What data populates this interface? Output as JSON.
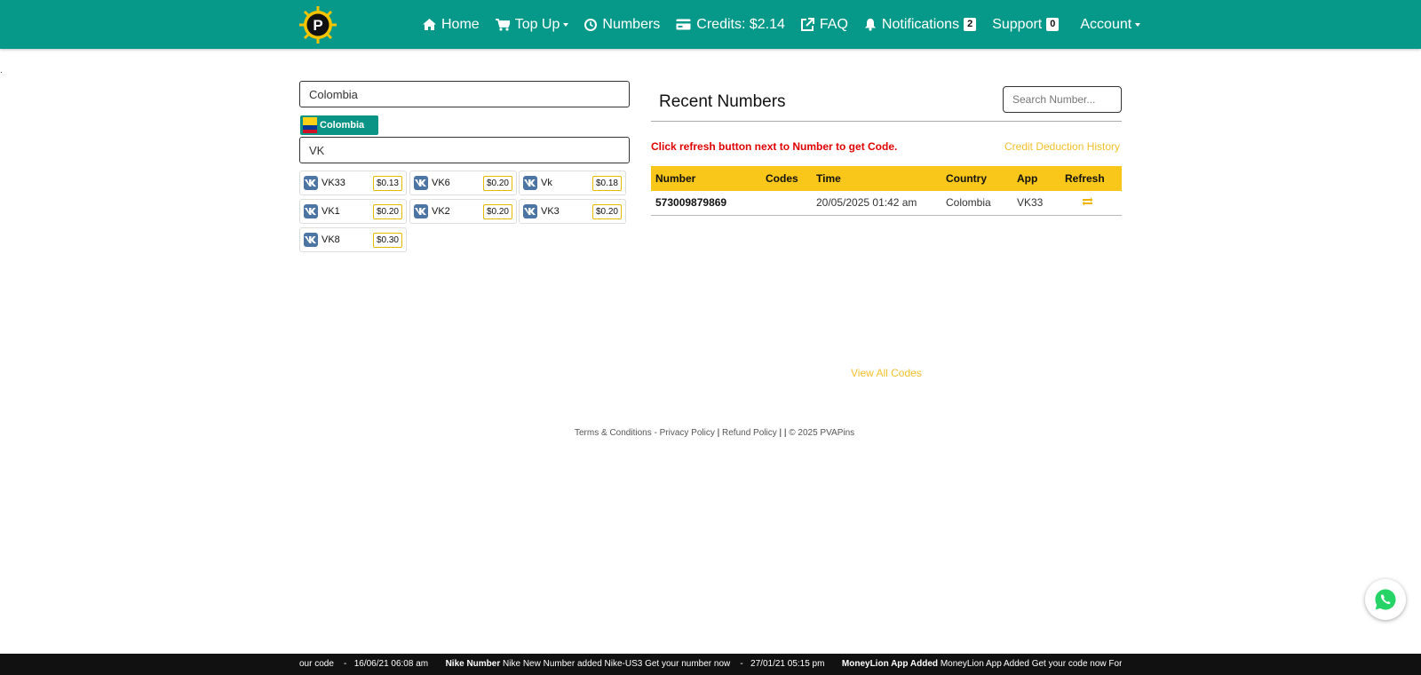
{
  "nav": {
    "home": "Home",
    "topup": "Top Up",
    "numbers": "Numbers",
    "credits": "Credits: $2.14",
    "faq": "FAQ",
    "notifications": "Notifications",
    "notifications_count": "2",
    "support": "Support",
    "support_count": "0",
    "account": "Account"
  },
  "logo_letter": "P",
  "dot": ".",
  "country_field": "Colombia",
  "country_chip": "Colombia",
  "service_field": "VK",
  "services": [
    {
      "name": "VK33",
      "price": "$0.13"
    },
    {
      "name": "VK6",
      "price": "$0.20"
    },
    {
      "name": "Vk",
      "price": "$0.18"
    },
    {
      "name": "VK1",
      "price": "$0.20"
    },
    {
      "name": "VK2",
      "price": "$0.20"
    },
    {
      "name": "VK3",
      "price": "$0.20"
    },
    {
      "name": "VK8",
      "price": "$0.30"
    }
  ],
  "recent": {
    "title": "Recent Numbers",
    "search_placeholder": "Search Number...",
    "warning": "Click refresh button next to Number to get Code.",
    "credit_history": "Credit Deduction History",
    "columns": [
      "Number",
      "Codes",
      "Time",
      "Country",
      "App",
      "Refresh"
    ],
    "rows": [
      {
        "number": "573009879869",
        "codes": "",
        "time": "20/05/2025 01:42 am",
        "country": "Colombia",
        "app": "VK33"
      }
    ],
    "view_all": "View All Codes"
  },
  "footer": {
    "terms": "Terms & Conditions",
    "privacy": "Privacy Policy",
    "refund": "Refund Policy",
    "copyright": "© 2025 PVAPins"
  },
  "ticker": {
    "t1": "our code",
    "d1": "16/06/21 06:08 am",
    "b2": "Nike Number",
    "t2": "Nike New Number added Nike-US3 Get your number now",
    "d2": "27/01/21 05:15 pm",
    "b3": "MoneyLion App Added",
    "t3": "MoneyLion App Added Get your code now For Bu"
  },
  "colors": {
    "navbar": "#06998a",
    "accent_yellow": "#f9c61a",
    "warning_red": "#e00000",
    "vk_blue": "#4c75a3",
    "whatsapp_green": "#25d366"
  }
}
